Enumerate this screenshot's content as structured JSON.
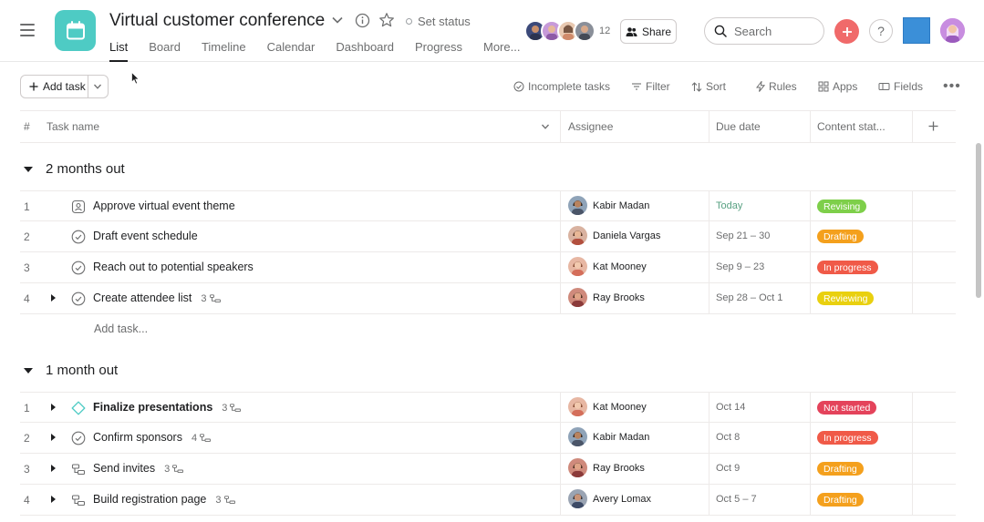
{
  "project": {
    "title": "Virtual customer conference",
    "set_status_label": "Set status",
    "tabs": [
      {
        "label": "List"
      },
      {
        "label": "Board"
      },
      {
        "label": "Timeline"
      },
      {
        "label": "Calendar"
      },
      {
        "label": "Dashboard"
      },
      {
        "label": "Progress"
      },
      {
        "label": "More..."
      }
    ],
    "member_count": "12",
    "share_label": "Share",
    "search_placeholder": "Search"
  },
  "toolbar": {
    "add_task_label": "Add task",
    "incomplete_label": "Incomplete tasks",
    "filter_label": "Filter",
    "sort_label": "Sort",
    "rules_label": "Rules",
    "apps_label": "Apps",
    "fields_label": "Fields"
  },
  "table": {
    "columns": {
      "num": "#",
      "task_name": "Task name",
      "assignee": "Assignee",
      "due_date": "Due date",
      "content_status": "Content stat..."
    },
    "add_task_placeholder": "Add task...",
    "sections": [
      {
        "title": "2 months out",
        "rows": [
          {
            "num": "1",
            "name": "Approve virtual event theme",
            "icon": "approval-icon",
            "subtasks": "",
            "assignee": "Kabir Madan",
            "due": "Today",
            "status": "Revising"
          },
          {
            "num": "2",
            "name": "Draft event schedule",
            "icon": "check-circle-icon",
            "subtasks": "",
            "assignee": "Daniela Vargas",
            "due": "Sep 21 – 30",
            "status": "Drafting"
          },
          {
            "num": "3",
            "name": "Reach out to potential speakers",
            "icon": "check-circle-icon",
            "subtasks": "",
            "assignee": "Kat Mooney",
            "due": "Sep 9 – 23",
            "status": "In progress"
          },
          {
            "num": "4",
            "name": "Create attendee list",
            "icon": "check-circle-icon",
            "subtasks": "3",
            "assignee": "Ray Brooks",
            "due": "Sep 28 – Oct 1",
            "status": "Reviewing"
          }
        ]
      },
      {
        "title": "1 month out",
        "rows": [
          {
            "num": "1",
            "name": "Finalize presentations",
            "icon": "milestone-icon",
            "subtasks": "3",
            "assignee": "Kat Mooney",
            "due": "Oct 14",
            "status": "Not started"
          },
          {
            "num": "2",
            "name": "Confirm sponsors",
            "icon": "check-circle-icon",
            "subtasks": "4",
            "assignee": "Kabir Madan",
            "due": "Oct 8",
            "status": "In progress"
          },
          {
            "num": "3",
            "name": "Send invites",
            "icon": "subtask-icon",
            "subtasks": "3",
            "assignee": "Ray Brooks",
            "due": "Oct 9",
            "status": "Drafting"
          },
          {
            "num": "4",
            "name": "Build registration page",
            "icon": "subtask-icon",
            "subtasks": "3",
            "assignee": "Avery Lomax",
            "due": "Oct 5 – 7",
            "status": "Drafting"
          }
        ]
      }
    ]
  },
  "colors": {
    "brand_teal": "#4ecbc4",
    "revising": "#7ecf4a",
    "drafting": "#f4a01d",
    "in_progress": "#f05a48",
    "reviewing": "#e9d00f",
    "not_started": "#e4435b",
    "today": "#58a182"
  }
}
